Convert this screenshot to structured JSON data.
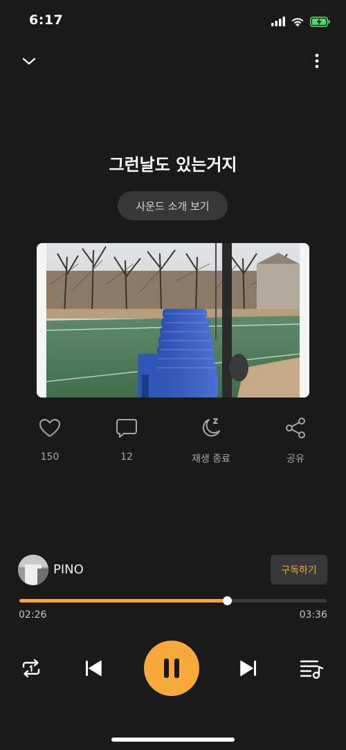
{
  "status_bar": {
    "time": "6:17"
  },
  "track": {
    "title": "그런날도 있는거지",
    "sound_intro_label": "사운드 소개 보기"
  },
  "actions": {
    "like_count": "150",
    "comment_count": "12",
    "sleep_timer_label": "재생 종료",
    "share_label": "공유"
  },
  "artist": {
    "name": "PINO",
    "subscribe_label": "구독하기"
  },
  "playback": {
    "elapsed": "02:26",
    "total": "03:36",
    "progress_fraction": 0.676
  },
  "colors": {
    "accent": "#f7a93a",
    "background": "#1a1a1a"
  },
  "icons": {
    "collapse": "chevron-down-icon",
    "more": "more-vertical-icon",
    "like": "heart-icon",
    "comment": "comment-icon",
    "sleep": "moon-sleep-icon",
    "share": "share-icon",
    "repeat": "repeat-one-icon",
    "previous": "skip-previous-icon",
    "pause": "pause-icon",
    "next": "skip-next-icon",
    "playlist": "playlist-icon"
  }
}
